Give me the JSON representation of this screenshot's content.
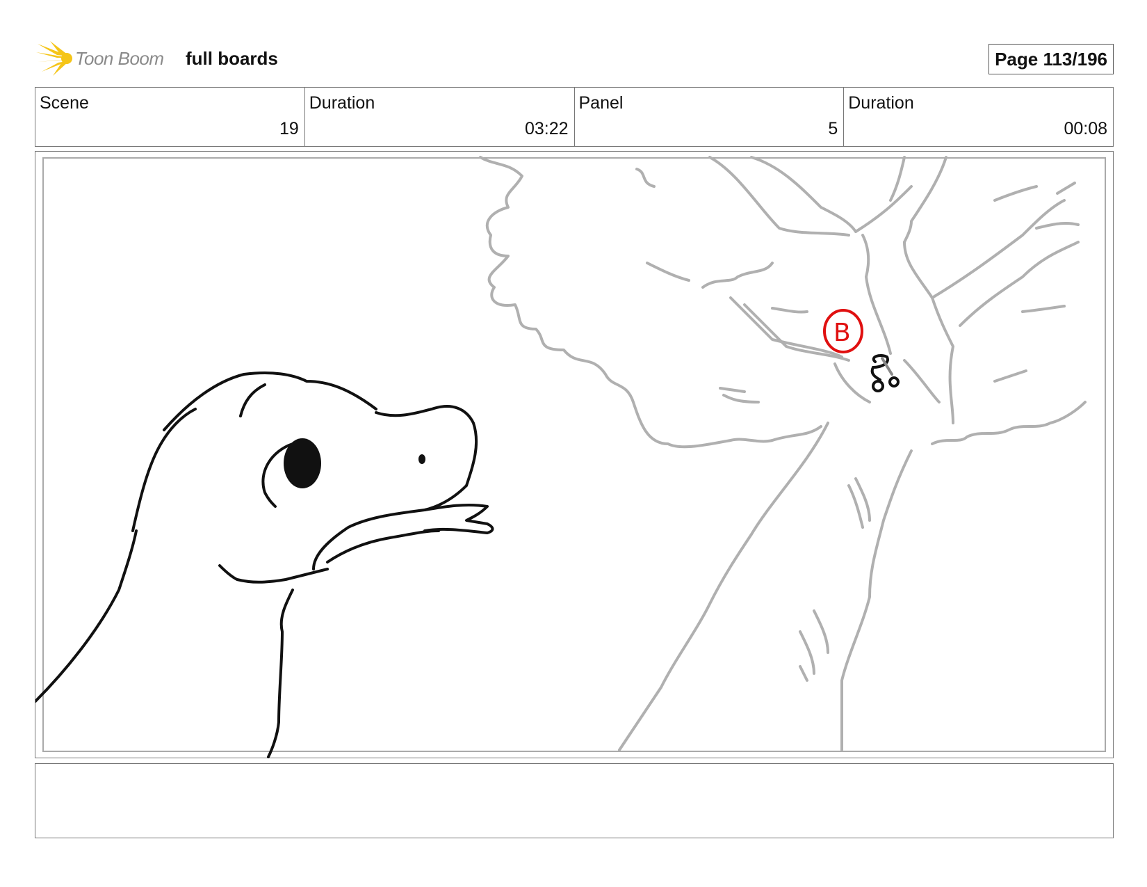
{
  "header": {
    "logo_text": "Toon Boom",
    "title": "full boards",
    "page_label": "Page 113/196"
  },
  "info": {
    "scene_label": "Scene",
    "scene_value": "19",
    "scene_duration_label": "Duration",
    "scene_duration_value": "03:22",
    "panel_label": "Panel",
    "panel_value": "5",
    "panel_duration_label": "Duration",
    "panel_duration_value": "00:08"
  },
  "colors": {
    "logo_yellow": "#f5c518",
    "sketch_black": "#111111",
    "sketch_gray": "#b0b0b0",
    "annotation_red": "#e01010"
  },
  "notes": {
    "text": ""
  }
}
